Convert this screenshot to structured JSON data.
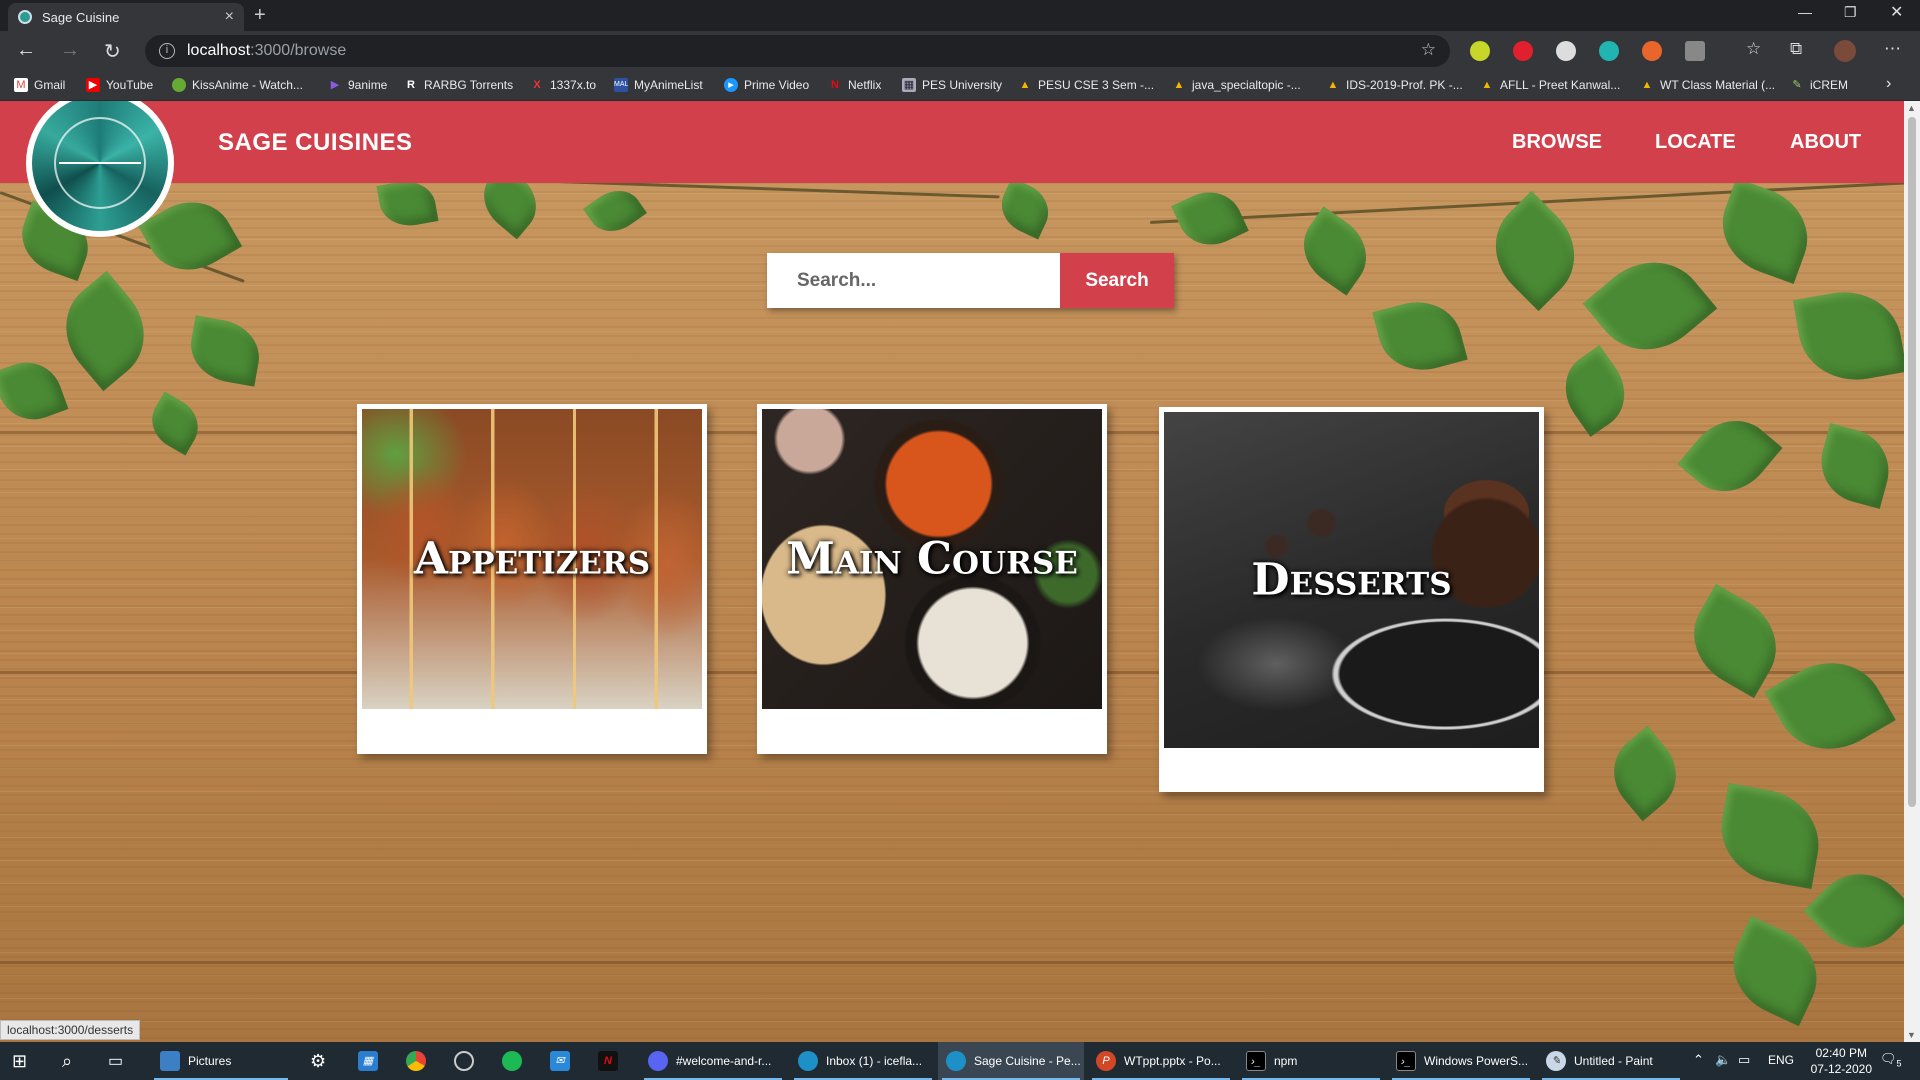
{
  "browser": {
    "tab_title": "Sage Cuisine",
    "url_host": "localhost",
    "url_path": ":3000/browse",
    "bookmarks": [
      "Gmail",
      "YouTube",
      "KissAnime - Watch...",
      "9anime",
      "RARBG Torrents",
      "1337x.to",
      "MyAnimeList",
      "Prime Video",
      "Netflix",
      "PES University",
      "PESU CSE 3 Sem -...",
      "java_specialtopic -...",
      "IDS-2019-Prof. PK -...",
      "AFLL - Preet Kanwal...",
      "WT Class Material (...",
      "iCREM"
    ],
    "status_link": "localhost:3000/desserts"
  },
  "site": {
    "brand": "SAGE CUISINES",
    "nav": [
      "BROWSE",
      "LOCATE",
      "ABOUT"
    ],
    "search_placeholder": "Search...",
    "search_button": "Search",
    "categories": [
      {
        "label": "Appetizers"
      },
      {
        "label": "Main Course"
      },
      {
        "label": "Desserts"
      }
    ],
    "colors": {
      "accent": "#d2404b",
      "logo": "#2a9d8f"
    }
  },
  "taskbar": {
    "items": [
      "Pictures",
      "#welcome-and-r...",
      "Inbox (1) - icefla...",
      "Sage Cuisine - Pe...",
      "WTppt.pptx - Po...",
      "npm",
      "Windows PowerS...",
      "Untitled - Paint"
    ],
    "lang": "ENG",
    "time": "02:40 PM",
    "date": "07-12-2020",
    "notifications": "5"
  }
}
